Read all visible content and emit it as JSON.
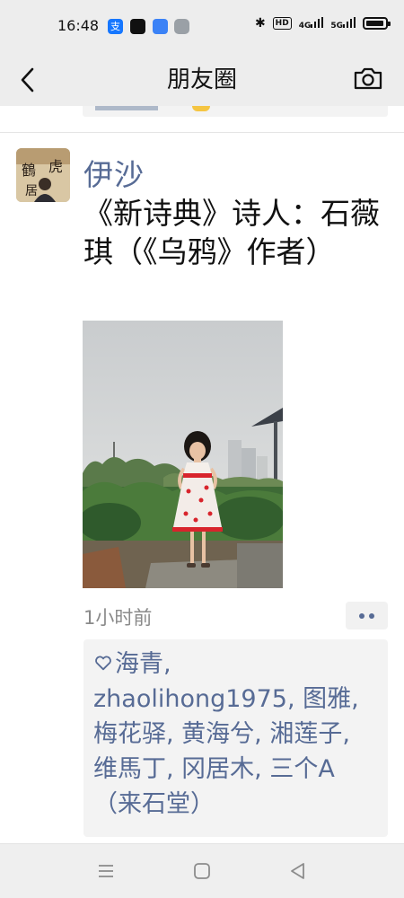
{
  "status_bar": {
    "time": "16:48",
    "app_icons": [
      "alipay-icon",
      "capcut-icon",
      "cloud-app-icon",
      "settings-app-icon"
    ],
    "alipay_glyph": "支",
    "hd_label": "HD",
    "signal_1": "4G",
    "signal_2": "5G"
  },
  "navbar": {
    "title": "朋友圈"
  },
  "post": {
    "author": "伊沙",
    "text": "《新诗典》诗人：石薇琪（《乌鸦》作者）",
    "timestamp": "1小时前",
    "likes": "海青, zhaolihong1975, 图雅, 梅花驿, 黄海兮, 湘莲子, 维馬丁, 冈居木, 三个A（来石堂）",
    "avatar_calligraphy": "鶴 虎 居"
  },
  "colors": {
    "link_blue": "#576b95",
    "header_bg": "#ededed",
    "likes_bg": "#f3f3f3"
  }
}
